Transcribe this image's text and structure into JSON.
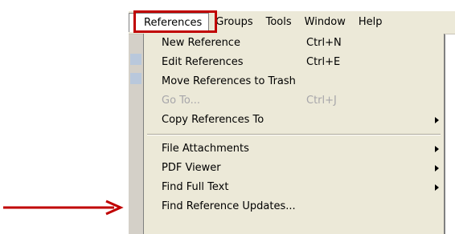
{
  "menubar": {
    "items": [
      {
        "label": "References"
      },
      {
        "label": "Groups"
      },
      {
        "label": "Tools"
      },
      {
        "label": "Window"
      },
      {
        "label": "Help"
      }
    ]
  },
  "dropdown": {
    "items": [
      {
        "label": "New Reference",
        "shortcut": "Ctrl+N"
      },
      {
        "label": "Edit References",
        "shortcut": "Ctrl+E"
      },
      {
        "label": "Move References to Trash",
        "shortcut": ""
      },
      {
        "label": "Go To...",
        "shortcut": "Ctrl+J"
      },
      {
        "label": "Copy References To",
        "shortcut": ""
      },
      {
        "label": "File Attachments",
        "shortcut": ""
      },
      {
        "label": "PDF Viewer",
        "shortcut": ""
      },
      {
        "label": "Find Full Text",
        "shortcut": ""
      },
      {
        "label": "Find Reference Updates...",
        "shortcut": ""
      }
    ]
  },
  "colors": {
    "highlight": "#c00000",
    "menu_bg": "#ece9d8",
    "disabled_text": "#a7a6aa"
  }
}
